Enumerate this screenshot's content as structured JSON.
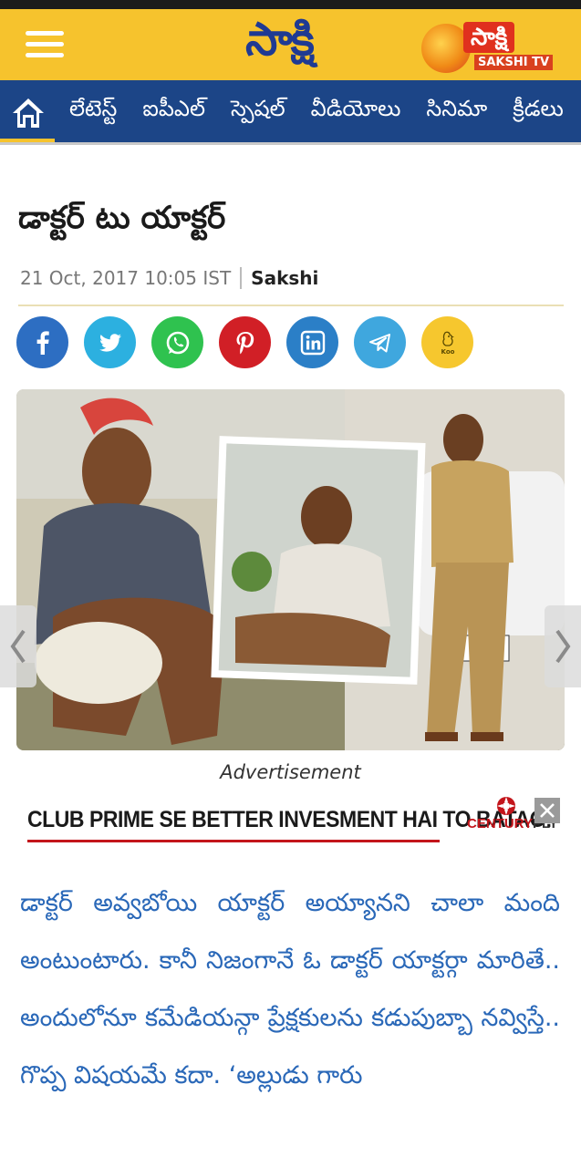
{
  "header": {
    "logo_text": "సాక్షి",
    "tv_logo_name": "సాక్షి",
    "tv_logo_sub": "SAKSHI TV",
    "colors": {
      "header_bg": "#f6c32d",
      "nav_bg": "#1c4587",
      "logo": "#1f3a93",
      "link_text": "#2a68b8"
    }
  },
  "nav": {
    "items": [
      {
        "label": "లేటెస్ట్"
      },
      {
        "label": "ఐపీఎల్"
      },
      {
        "label": "స్పెషల్"
      },
      {
        "label": "వీడియోలు"
      },
      {
        "label": "సినిమా"
      },
      {
        "label": "క్రీడలు"
      }
    ]
  },
  "article": {
    "title": "డాక్టర్ టు యాక్టర్",
    "date": "21 Oct, 2017 10:05 IST",
    "source": "Sakshi",
    "share": [
      {
        "icon": "facebook-icon"
      },
      {
        "icon": "twitter-icon"
      },
      {
        "icon": "whatsapp-icon"
      },
      {
        "icon": "pinterest-icon"
      },
      {
        "icon": "linkedin-icon"
      },
      {
        "icon": "telegram-icon"
      },
      {
        "icon": "koo-icon",
        "label": "Koo"
      }
    ],
    "body": "డాక్టర్ అవ్వబోయి యాక్టర్ అయ్యానని చాలా మంది అంటుంటారు. కానీ నిజంగానే ఓ డాక్టర్ యాక్టర్గా మారితే.. అందులోనూ కమేడియన్గా ప్రేక్షకులను కడుపుబ్బా నవ్విస్తే.. గొప్ప విషయమే కదా. ‘అల్లుడు గారు"
  },
  "ad": {
    "label": "Advertisement",
    "text": "CLUB PRIME SE BETTER INVESMENT HAI TO BATAO!",
    "brand_main": "CENTURY",
    "brand_ply": "PLY"
  }
}
